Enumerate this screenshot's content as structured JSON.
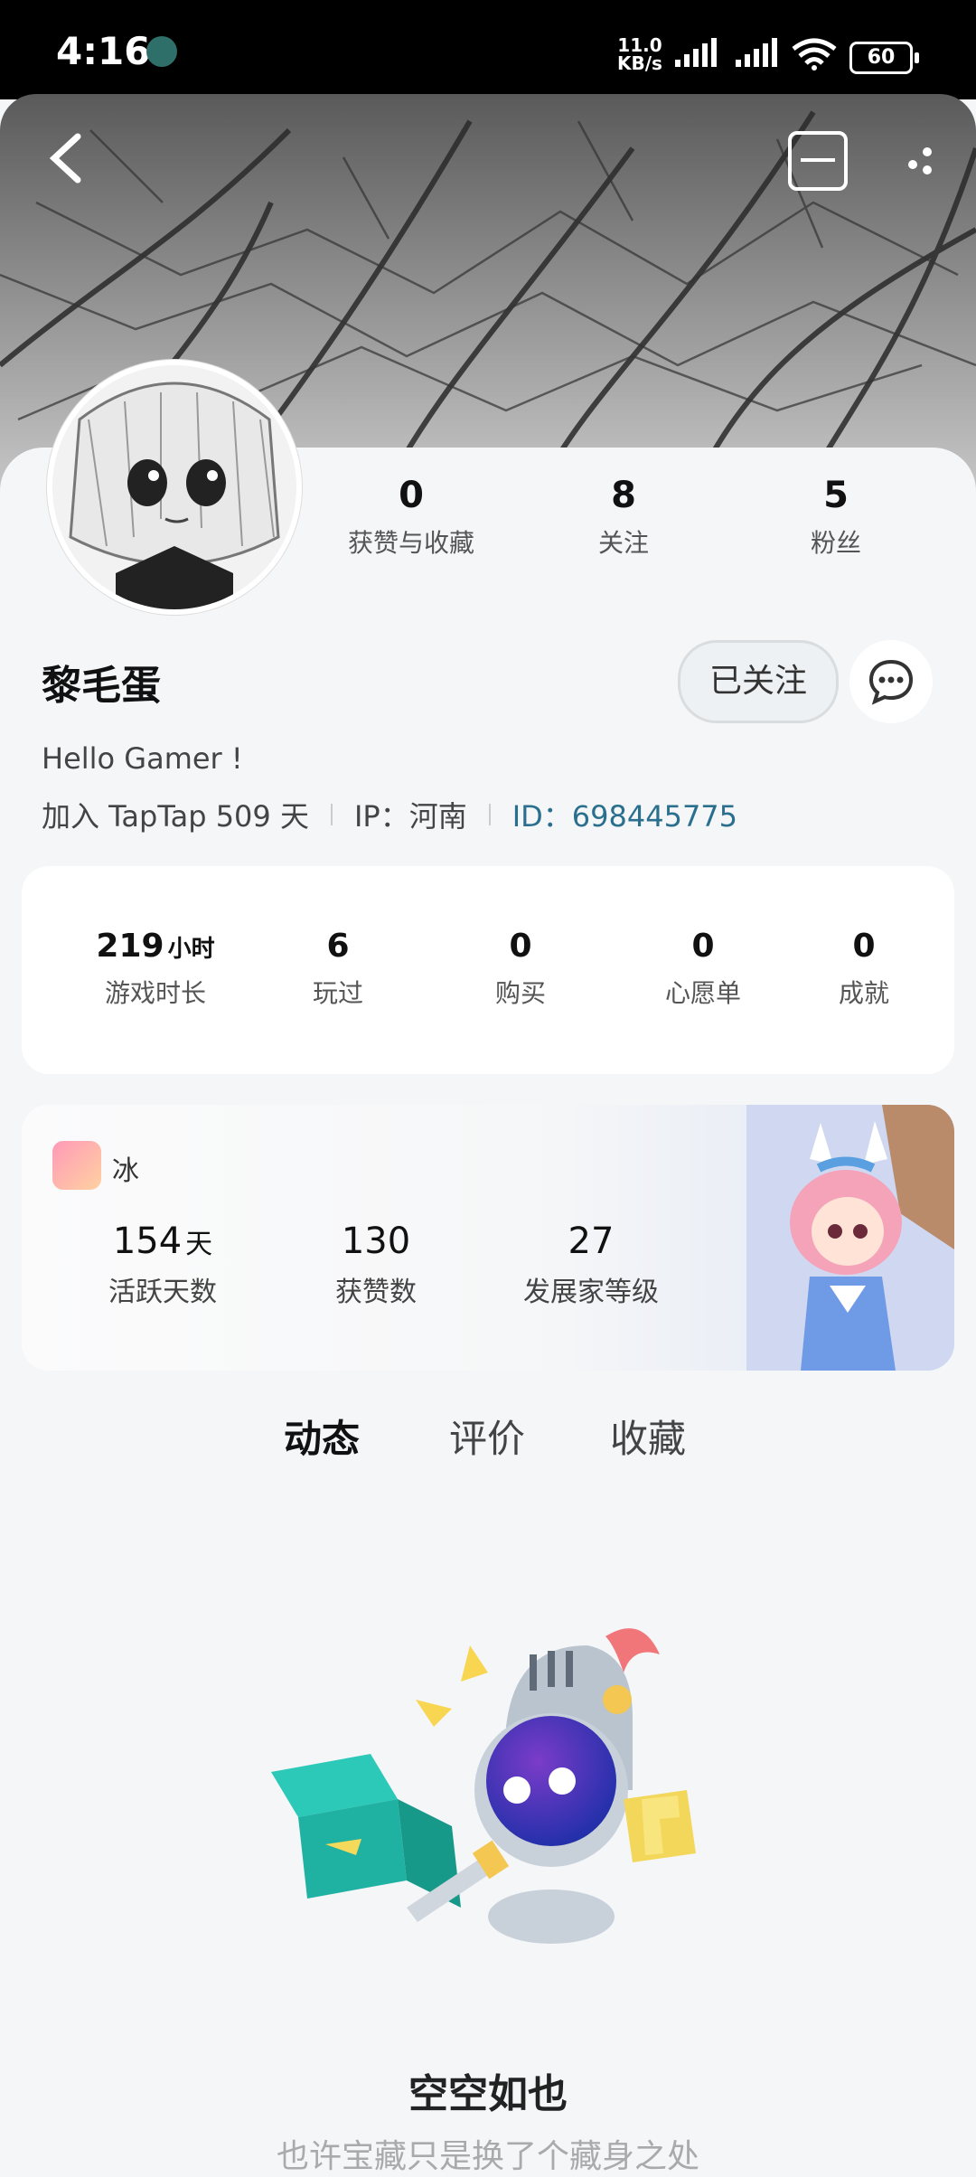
{
  "status_bar": {
    "time": "4:16",
    "net_speed_value": "11.0",
    "net_speed_unit": "KB/s",
    "battery": "60"
  },
  "profile": {
    "name": "黎毛蛋",
    "bio": "Hello Gamer !",
    "joined": "加入 TapTap 509 天",
    "ip": "IP：河南",
    "id": "ID：698445775",
    "follow_label": "已关注",
    "stats": [
      {
        "value": "0",
        "label": "获赞与收藏"
      },
      {
        "value": "8",
        "label": "关注"
      },
      {
        "value": "5",
        "label": "粉丝"
      }
    ]
  },
  "game_stats": {
    "play_time": {
      "value": "219",
      "unit": "小时",
      "label": "游戏时长"
    },
    "played": {
      "value": "6",
      "label": "玩过"
    },
    "purchased": {
      "value": "0",
      "label": "购买"
    },
    "wishlist": {
      "value": "0",
      "label": "心愿单"
    },
    "achievements": {
      "value": "0",
      "label": "成就"
    }
  },
  "developer_card": {
    "game_name": "冰",
    "active_days": {
      "value": "154",
      "unit": "天",
      "label": "活跃天数"
    },
    "likes": {
      "value": "130",
      "label": "获赞数"
    },
    "level": {
      "value": "27",
      "label": "发展家等级"
    }
  },
  "tabs": [
    "动态",
    "评价",
    "收藏"
  ],
  "empty_state": {
    "title": "空空如也",
    "subtitle": "也许宝藏只是换了个藏身之处"
  },
  "colors": {
    "accent": "#24d0c6",
    "id_link": "#2b6f8f"
  }
}
